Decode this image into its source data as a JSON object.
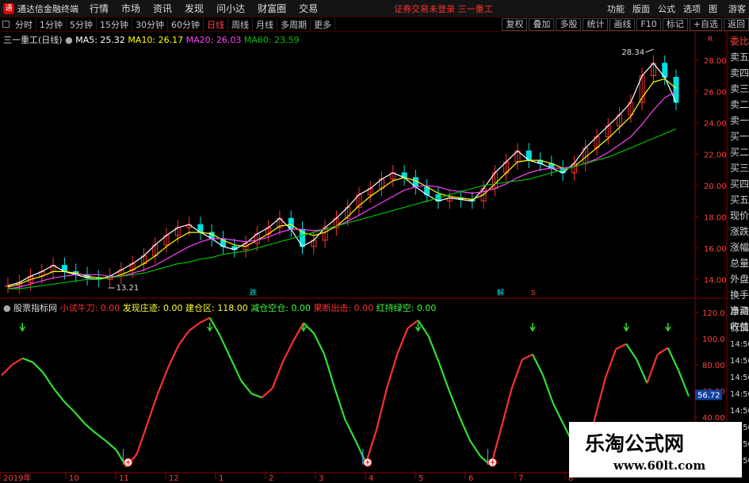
{
  "titlebar": {
    "app_title": "通达信金融终端",
    "logo_text": "通",
    "menus": [
      "行情",
      "市场",
      "资讯",
      "发现",
      "问小达",
      "财富圈",
      "交易"
    ],
    "notice": "证券交易未登录  三一重工",
    "right_items": [
      "功能",
      "版面",
      "公式",
      "选项"
    ],
    "window_controls": [
      "图",
      "游客"
    ]
  },
  "periodbar": {
    "periods": [
      "分时",
      "1分钟",
      "5分钟",
      "15分钟",
      "30分钟",
      "60分钟",
      "日线",
      "周线",
      "月线",
      "多周期",
      "更多"
    ],
    "active": "日线",
    "tools": [
      "复权",
      "叠加",
      "多股",
      "统计",
      "画线",
      "F10",
      "标记",
      "+自选",
      "返回"
    ]
  },
  "price_legend": {
    "name": "三一重工(日线)",
    "ma5": "MA5: 25.32",
    "ma10": "MA10: 26.17",
    "ma20": "MA20: 26.03",
    "ma60": "MA60: 23.59"
  },
  "price_axis": [
    "28.00",
    "26.00",
    "24.00",
    "22.00",
    "20.00",
    "18.00",
    "16.00",
    "14.00"
  ],
  "price_axis_top_label": "28.34",
  "price_axis_pct": "R",
  "annotations": {
    "high": "28.34",
    "low": "13.21",
    "signal1": "跌",
    "signal2": "解",
    "signal3": "S"
  },
  "indicator_legend": {
    "name": "股票指标网",
    "items": [
      {
        "label": "小试牛刀: 0.00",
        "color": "#ff3030"
      },
      {
        "label": "发现庄迹: 0.00",
        "color": "#ffff40"
      },
      {
        "label": "建仓区: 118.00",
        "color": "#ffff40"
      },
      {
        "label": "减仓空仓: 0.00",
        "color": "#40ff40"
      },
      {
        "label": "果断出击: 0.00",
        "color": "#ff3030"
      },
      {
        "label": "红持绿空: 0.00",
        "color": "#40ff40"
      }
    ]
  },
  "indicator_axis": [
    "120.0",
    "100.0",
    "80.00",
    "60.00",
    "40.00"
  ],
  "indicator_current": "56.72",
  "time_axis": [
    "2019年",
    "10",
    "11",
    "12",
    "1",
    "2",
    "3",
    "4",
    "5",
    "6",
    "7",
    "8"
  ],
  "right_panel": [
    "委比",
    "卖五",
    "卖四",
    "卖三",
    "卖二",
    "卖一",
    "买一",
    "买二",
    "买三",
    "买四",
    "买五",
    "现价",
    "涨跌",
    "涨幅",
    "总量",
    "外盘",
    "换手",
    "净资",
    "收益"
  ],
  "right_panel2": [
    "自动",
    "行情",
    "14:50",
    "14:50",
    "14:50",
    "14:50",
    "14:50",
    "14:50",
    "14:50",
    "14:50"
  ],
  "watermark": {
    "line1": "乐淘公式网",
    "line2": "www.60lt.com"
  },
  "colors": {
    "up": "#ff3232",
    "down": "#00e0e0",
    "ma5": "#ffffff",
    "ma10": "#ffff00",
    "ma20": "#ff40ff",
    "ma60": "#00c000",
    "bg": "#000000",
    "grid": "#8b0000"
  },
  "chart_data": {
    "type": "line",
    "title": "",
    "price_series": [
      {
        "name": "MA5",
        "values": [
          13.6,
          13.8,
          14.2,
          14.5,
          14.9,
          14.5,
          14.3,
          14.1,
          14.0,
          14.2,
          14.6,
          15.0,
          15.5,
          16.2,
          16.8,
          17.3,
          17.5,
          17.0,
          16.6,
          16.1,
          15.9,
          16.3,
          16.9,
          17.3,
          17.9,
          17.2,
          16.1,
          16.5,
          17.3,
          17.9,
          18.6,
          19.4,
          19.8,
          20.4,
          20.8,
          20.5,
          19.9,
          19.4,
          19.0,
          19.2,
          19.1,
          19.0,
          19.8,
          20.8,
          21.5,
          22.2,
          21.6,
          21.4,
          21.1,
          20.8,
          21.4,
          22.4,
          23.1,
          23.8,
          24.5,
          25.3,
          27.0,
          27.8,
          26.9,
          25.3
        ]
      },
      {
        "name": "MA10",
        "values": [
          13.5,
          13.7,
          14.0,
          14.2,
          14.5,
          14.5,
          14.4,
          14.2,
          14.1,
          14.1,
          14.3,
          14.6,
          15.0,
          15.5,
          16.1,
          16.6,
          17.0,
          17.0,
          16.9,
          16.5,
          16.2,
          16.1,
          16.5,
          16.9,
          17.4,
          17.5,
          17.0,
          16.8,
          17.0,
          17.4,
          18.0,
          18.7,
          19.3,
          19.8,
          20.3,
          20.5,
          20.3,
          19.9,
          19.5,
          19.3,
          19.2,
          19.1,
          19.4,
          20.1,
          20.8,
          21.5,
          21.6,
          21.6,
          21.4,
          21.1,
          21.2,
          21.8,
          22.4,
          23.0,
          23.7,
          24.4,
          25.6,
          26.6,
          26.8,
          26.2
        ]
      },
      {
        "name": "MA20",
        "values": [
          13.4,
          13.5,
          13.7,
          13.9,
          14.1,
          14.2,
          14.3,
          14.3,
          14.3,
          14.2,
          14.2,
          14.4,
          14.6,
          14.9,
          15.3,
          15.7,
          16.1,
          16.4,
          16.6,
          16.6,
          16.5,
          16.4,
          16.5,
          16.7,
          17.0,
          17.2,
          17.2,
          17.1,
          17.2,
          17.4,
          17.7,
          18.1,
          18.5,
          18.9,
          19.3,
          19.7,
          19.9,
          20.0,
          19.9,
          19.7,
          19.6,
          19.5,
          19.6,
          19.8,
          20.1,
          20.5,
          20.8,
          21.0,
          21.1,
          21.1,
          21.2,
          21.4,
          21.7,
          22.1,
          22.6,
          23.1,
          23.9,
          24.8,
          25.6,
          26.0
        ]
      },
      {
        "name": "MA60",
        "values": [
          13.4,
          13.4,
          13.5,
          13.6,
          13.7,
          13.8,
          13.9,
          14.0,
          14.0,
          14.1,
          14.2,
          14.3,
          14.4,
          14.6,
          14.8,
          15.0,
          15.1,
          15.3,
          15.4,
          15.6,
          15.7,
          15.8,
          16.0,
          16.2,
          16.4,
          16.6,
          16.8,
          17.0,
          17.2,
          17.4,
          17.6,
          17.8,
          18.0,
          18.2,
          18.4,
          18.6,
          18.8,
          19.0,
          19.2,
          19.4,
          19.6,
          19.8,
          20.0,
          20.1,
          20.2,
          20.3,
          20.4,
          20.6,
          20.8,
          21.0,
          21.2,
          21.4,
          21.6,
          21.8,
          22.1,
          22.4,
          22.7,
          23.0,
          23.3,
          23.6
        ]
      }
    ],
    "ylim": [
      13,
      29
    ],
    "indicator_values": [
      72,
      80,
      85,
      82,
      74,
      62,
      52,
      44,
      35,
      28,
      22,
      15,
      2,
      12,
      35,
      58,
      78,
      95,
      106,
      112,
      116,
      102,
      85,
      68,
      58,
      55,
      62,
      82,
      98,
      112,
      104,
      88,
      62,
      38,
      22,
      5,
      30,
      62,
      88,
      108,
      114,
      102,
      82,
      60,
      40,
      22,
      10,
      3,
      32,
      62,
      84,
      88,
      72,
      50,
      34,
      18,
      5,
      40,
      70,
      92,
      96,
      84,
      66,
      88,
      93,
      76,
      56
    ],
    "indicator_ylim": [
      0,
      120
    ]
  }
}
